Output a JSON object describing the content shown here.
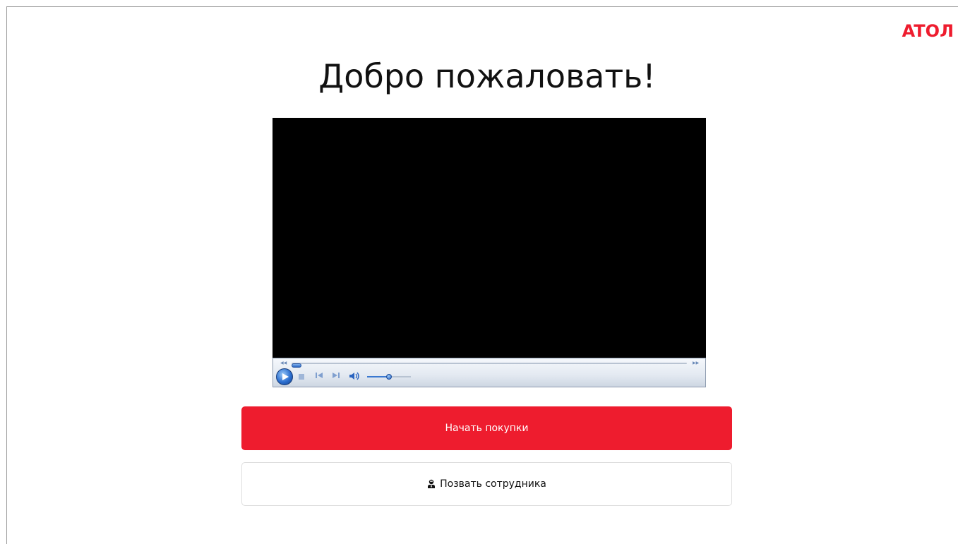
{
  "brand": {
    "logo_text": "ATOЛ",
    "accent_color": "#ee1c2e"
  },
  "page": {
    "title": "Добро пожаловать!"
  },
  "video_player": {
    "icons": [
      "play-icon",
      "stop-icon",
      "previous-icon",
      "next-icon",
      "volume-icon"
    ],
    "seek_position": 0.0,
    "volume_level": 0.5
  },
  "actions": {
    "start_shopping_label": "Начать покупки",
    "call_staff_label": "Позвать сотрудника",
    "call_staff_icon": "staff-person-icon"
  }
}
